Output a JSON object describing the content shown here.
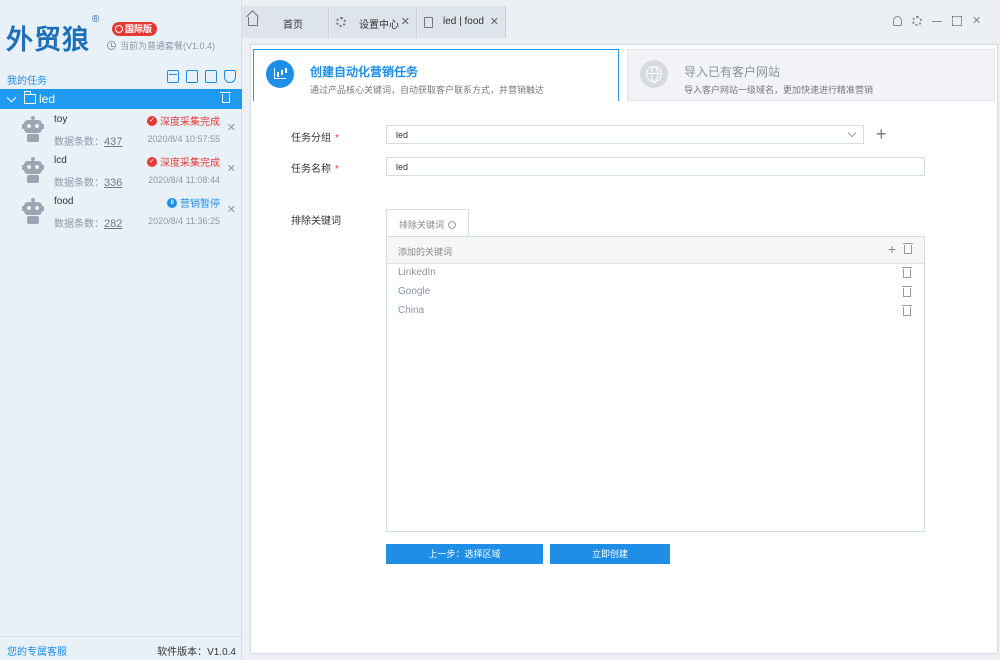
{
  "brand": {
    "logo": "外贸狼",
    "reg": "®",
    "edition_badge": "国际版",
    "version_line": "当前为普通套餐(V1.0.4)"
  },
  "sidebar": {
    "section_title": "我的任务",
    "group": {
      "label": "led"
    },
    "tasks": [
      {
        "name": "toy",
        "count_label": "数据条数：",
        "count": "437",
        "status": "深度采集完成",
        "status_color": "#e53935",
        "time": "2020/8/4 10:57:55"
      },
      {
        "name": "lcd",
        "count_label": "数据条数：",
        "count": "336",
        "status": "深度采集完成",
        "status_color": "#e53935",
        "time": "2020/8/4 11:08:44"
      },
      {
        "name": "food",
        "count_label": "数据条数：",
        "count": "282",
        "status": "营销暂停",
        "status_color": "#1e8ee6",
        "time": "2020/8/4 11:36:25"
      }
    ],
    "footer_left": "您的专属客服",
    "footer_right": "软件版本：V1.0.4"
  },
  "tabs": [
    {
      "label": "首页",
      "icon": "home-icon"
    },
    {
      "label": "设置中心",
      "icon": "gear-icon"
    },
    {
      "label": "led | food",
      "icon": "file-icon"
    }
  ],
  "steps": [
    {
      "title": "创建自动化营销任务",
      "desc": "通过产品核心关键词，自动获取客户联系方式，并营销触达",
      "icon": "chart-icon"
    },
    {
      "title": "导入已有客户网站",
      "desc": "导入客户网站一级域名，更加快速进行精准营销",
      "icon": "globe-icon"
    }
  ],
  "form": {
    "group_label": "任务分组",
    "group_value": "led",
    "name_label": "任务名称",
    "name_value": "led",
    "required_mark": "*",
    "exclude_label": "排除关键词",
    "kw_tab_label": "排除关键词",
    "kw_head_label": "添加的关键词",
    "keywords": [
      "LinkedIn",
      "Google",
      "China"
    ]
  },
  "buttons": {
    "prev": "上一步：选择区域",
    "create": "立即创建"
  },
  "colors": {
    "accent": "#1e8ee6",
    "danger": "#e53935"
  }
}
